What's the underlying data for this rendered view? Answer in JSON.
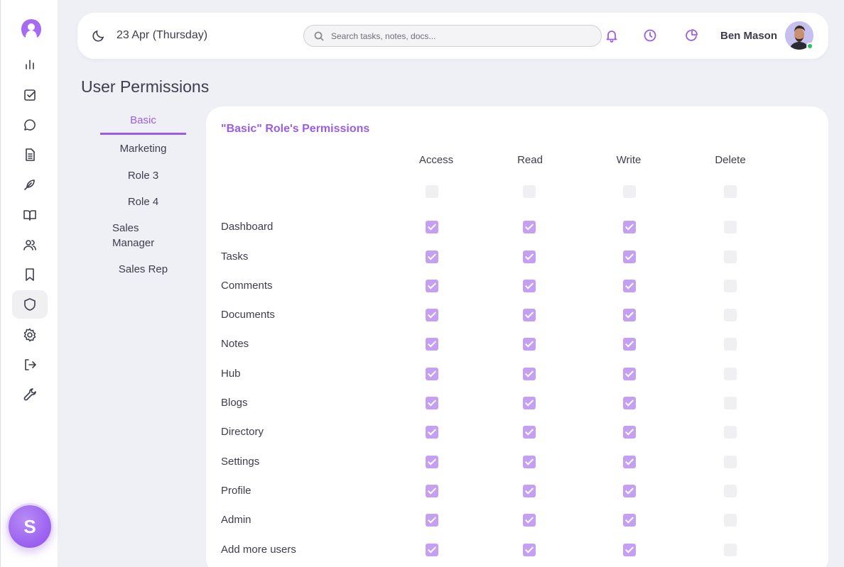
{
  "header": {
    "date": "23 Apr (Thursday)",
    "search_placeholder": "Search tasks, notes, docs...",
    "username": "Ben Mason"
  },
  "sidebar": {
    "icons": [
      "dashboard-chart-icon",
      "tasks-check-icon",
      "comments-icon",
      "documents-icon",
      "notes-feather-icon",
      "hub-book-icon",
      "directory-users-icon",
      "bookmark-icon",
      "admin-shield-icon",
      "settings-gear-icon",
      "logout-icon",
      "tools-wrench-icon"
    ],
    "active": "admin-shield-icon",
    "brand_letter": "S"
  },
  "page": {
    "title": "User Permissions"
  },
  "roles": [
    {
      "label": "Basic",
      "active": true
    },
    {
      "label": "Marketing"
    },
    {
      "label": "Role 3"
    },
    {
      "label": "Role 4"
    },
    {
      "label": "Sales Manager"
    },
    {
      "label": "Sales Rep"
    }
  ],
  "permissions": {
    "title": "\"Basic\" Role's Permissions",
    "columns": [
      "Access",
      "Read",
      "Write",
      "Delete"
    ],
    "rows": [
      {
        "label": "Dashboard",
        "values": [
          true,
          true,
          true,
          false
        ]
      },
      {
        "label": "Tasks",
        "values": [
          true,
          true,
          true,
          false
        ]
      },
      {
        "label": "Comments",
        "values": [
          true,
          true,
          true,
          false
        ]
      },
      {
        "label": "Documents",
        "values": [
          true,
          true,
          true,
          false
        ]
      },
      {
        "label": "Notes",
        "values": [
          true,
          true,
          true,
          false
        ]
      },
      {
        "label": "Hub",
        "values": [
          true,
          true,
          true,
          false
        ]
      },
      {
        "label": "Blogs",
        "values": [
          true,
          true,
          true,
          false
        ]
      },
      {
        "label": "Directory",
        "values": [
          true,
          true,
          true,
          false
        ]
      },
      {
        "label": "Settings",
        "values": [
          true,
          true,
          true,
          false
        ]
      },
      {
        "label": "Profile",
        "values": [
          true,
          true,
          true,
          false
        ]
      },
      {
        "label": "Admin",
        "values": [
          true,
          true,
          true,
          false
        ]
      },
      {
        "label": "Add more users",
        "values": [
          true,
          true,
          true,
          false
        ]
      }
    ],
    "select_all": [
      false,
      false,
      false,
      false
    ]
  },
  "colors": {
    "accent": "#9b5de5",
    "checked": "#c59ff2",
    "online": "#22c55e"
  }
}
